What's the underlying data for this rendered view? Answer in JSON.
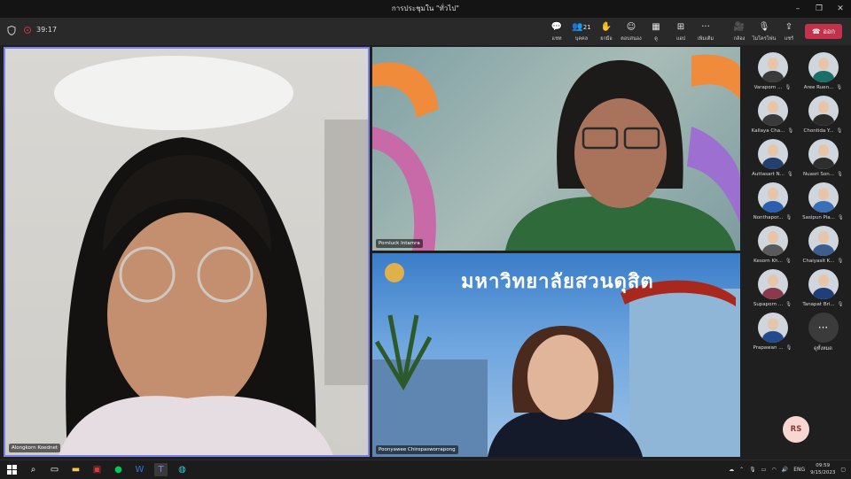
{
  "window": {
    "title": "การประชุมใน \"ทั่วไป\"",
    "controls": [
      "–",
      "❐",
      "✕"
    ]
  },
  "meeting": {
    "timer": "39:17"
  },
  "toolbar": {
    "chat": "แชท",
    "people_count": "21",
    "people": "บุคคล",
    "raise": "ยกมือ",
    "react": "ตอบสนอง",
    "view": "ดู",
    "apps": "แอป",
    "more": "เพิ่มเติม",
    "camera": "กล้อง",
    "mic": "ไมโครโฟน",
    "share": "แชร์",
    "leave": "ออก"
  },
  "videos": {
    "main": {
      "name": "Alongkorn Koednet"
    },
    "top_right": {
      "name": "Pornluck Intamra"
    },
    "bottom_right": {
      "name": "Poonyawee Chiropasworrapong",
      "banner": "มหาวิทยาลัยสวนดุสิต"
    }
  },
  "participants": [
    {
      "name": "Varaporn ...",
      "color": "#3a3a3a"
    },
    {
      "name": "Aree Ruen...",
      "color": "#1b6f6a"
    },
    {
      "name": "Kallaya Cha...",
      "color": "#3a3a3a"
    },
    {
      "name": "Chontida Y...",
      "color": "#2b2b2b"
    },
    {
      "name": "Auttasart N...",
      "color": "#24406e"
    },
    {
      "name": "Nuasri Son...",
      "color": "#2e2e2e"
    },
    {
      "name": "Nonthapor...",
      "color": "#2a5fb0"
    },
    {
      "name": "Sasipun Pia...",
      "color": "#3a6fb8"
    },
    {
      "name": "Kesorn Kh...",
      "color": "#5a5a5a"
    },
    {
      "name": "Chaiyasit K...",
      "color": "#3d5d8e"
    },
    {
      "name": "Supaporn ...",
      "color": "#8a3a4a"
    },
    {
      "name": "Tanapat Bri...",
      "color": "#203f7a"
    },
    {
      "name": "Prapawan ...",
      "color": "#244a8e"
    }
  ],
  "more_people": {
    "label": "ดูทั้งหมด"
  },
  "self_avatar": {
    "initials": "RS"
  },
  "taskbar": {
    "lang": "ENG",
    "time": "09:59",
    "date": "9/15/2023"
  }
}
